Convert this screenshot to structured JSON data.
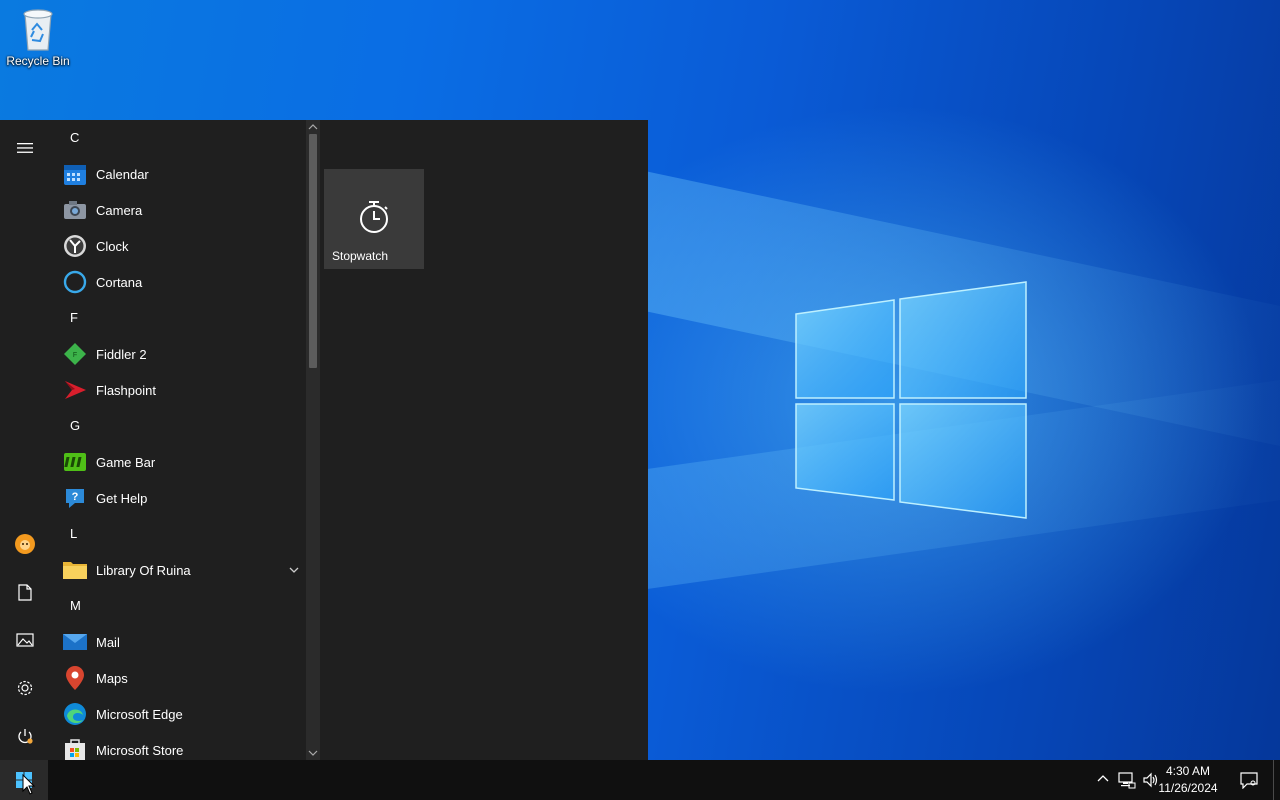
{
  "desktop": {
    "icons": [
      {
        "label": "Recycle Bin",
        "icon": "recycle-bin-icon"
      }
    ]
  },
  "start_menu": {
    "rail": [
      {
        "icon": "hamburger-menu-icon"
      },
      {
        "icon": "user-avatar-icon"
      },
      {
        "icon": "documents-icon"
      },
      {
        "icon": "pictures-icon"
      },
      {
        "icon": "settings-gear-icon"
      },
      {
        "icon": "power-icon"
      }
    ],
    "groups": [
      {
        "letter": "C",
        "apps": [
          {
            "name": "Calendar",
            "icon": "calendar-icon"
          },
          {
            "name": "Camera",
            "icon": "camera-icon"
          },
          {
            "name": "Clock",
            "icon": "clock-icon"
          },
          {
            "name": "Cortana",
            "icon": "cortana-icon"
          }
        ]
      },
      {
        "letter": "F",
        "apps": [
          {
            "name": "Fiddler 2",
            "icon": "fiddler-icon"
          },
          {
            "name": "Flashpoint",
            "icon": "flashpoint-icon"
          }
        ]
      },
      {
        "letter": "G",
        "apps": [
          {
            "name": "Game Bar",
            "icon": "game-bar-icon"
          },
          {
            "name": "Get Help",
            "icon": "get-help-icon"
          }
        ]
      },
      {
        "letter": "L",
        "apps": [
          {
            "name": "Library Of Ruina",
            "icon": "folder-icon",
            "expandable": true
          }
        ]
      },
      {
        "letter": "M",
        "apps": [
          {
            "name": "Mail",
            "icon": "mail-icon"
          },
          {
            "name": "Maps",
            "icon": "maps-icon"
          },
          {
            "name": "Microsoft Edge",
            "icon": "edge-icon"
          },
          {
            "name": "Microsoft Store",
            "icon": "store-icon"
          }
        ]
      }
    ],
    "tiles": [
      {
        "name": "Stopwatch",
        "icon": "stopwatch-icon"
      }
    ]
  },
  "taskbar": {
    "start_icon": "windows-logo-icon",
    "tray_icons": [
      "chevron-up-icon",
      "network-icon",
      "volume-icon"
    ],
    "time": "4:30 AM",
    "date": "11/26/2024",
    "notification_icon": "action-center-icon"
  },
  "colors": {
    "start_bg": "#1f1f1f",
    "tile_bg": "#3a3a3a",
    "taskbar_bg": "#101010"
  }
}
